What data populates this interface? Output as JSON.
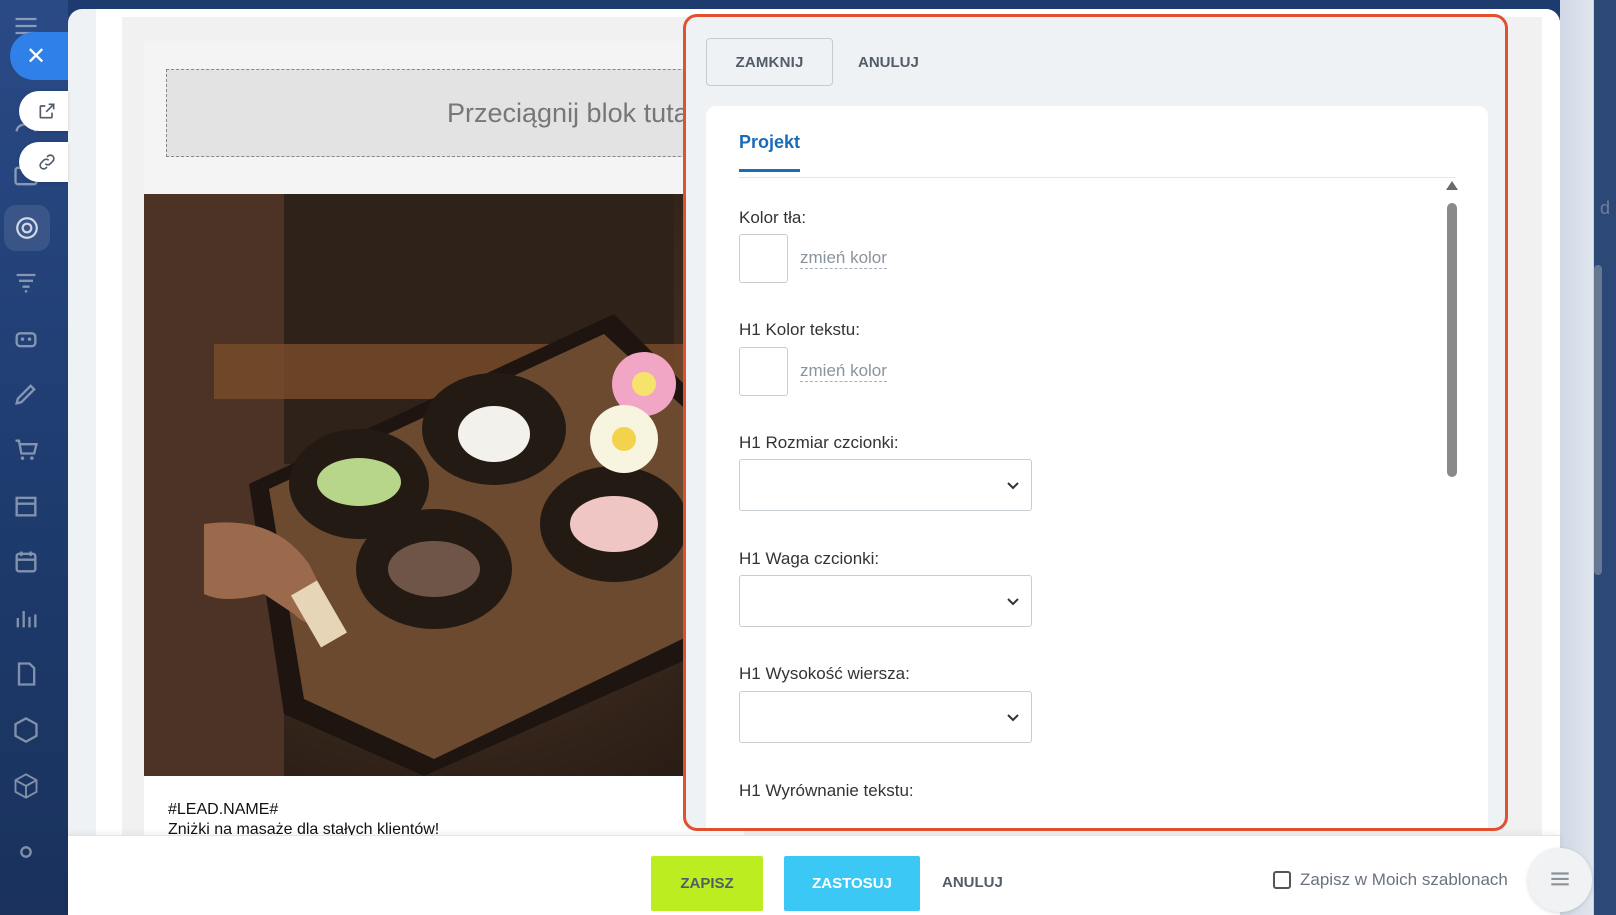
{
  "settings_panel": {
    "close_label": "ZAMKNIJ",
    "cancel_label": "ANULUJ",
    "tab_label": "Projekt",
    "fields": {
      "bg_color_label": "Kolor tła:",
      "h1_text_color_label": "H1 Kolor tekstu:",
      "h1_font_size_label": "H1 Rozmiar czcionki:",
      "h1_font_weight_label": "H1 Waga czcionki:",
      "h1_line_height_label": "H1 Wysokość wiersza:",
      "h1_text_align_label": "H1 Wyrównanie tekstu:"
    },
    "change_color_label": "zmień kolor"
  },
  "email_preview": {
    "drop_zone_text": "Przeciągnij blok tutaj",
    "lead_name": "#LEAD.NAME#",
    "promo_text": "Zniżki na masaże dla stałych klientów!"
  },
  "bottom_bar": {
    "save_label": "ZAPISZ",
    "apply_label": "ZASTOSUJ",
    "cancel_label": "ANULUJ",
    "save_template_label": "Zapisz w Moich szablonach"
  },
  "right_strip_text": "d",
  "colors": {
    "highlight_border": "#e0512e",
    "save_button": "#bbed21",
    "apply_button": "#3bc8f5",
    "active_tab": "#1a6bb8",
    "close_button": "#2f80e8"
  }
}
